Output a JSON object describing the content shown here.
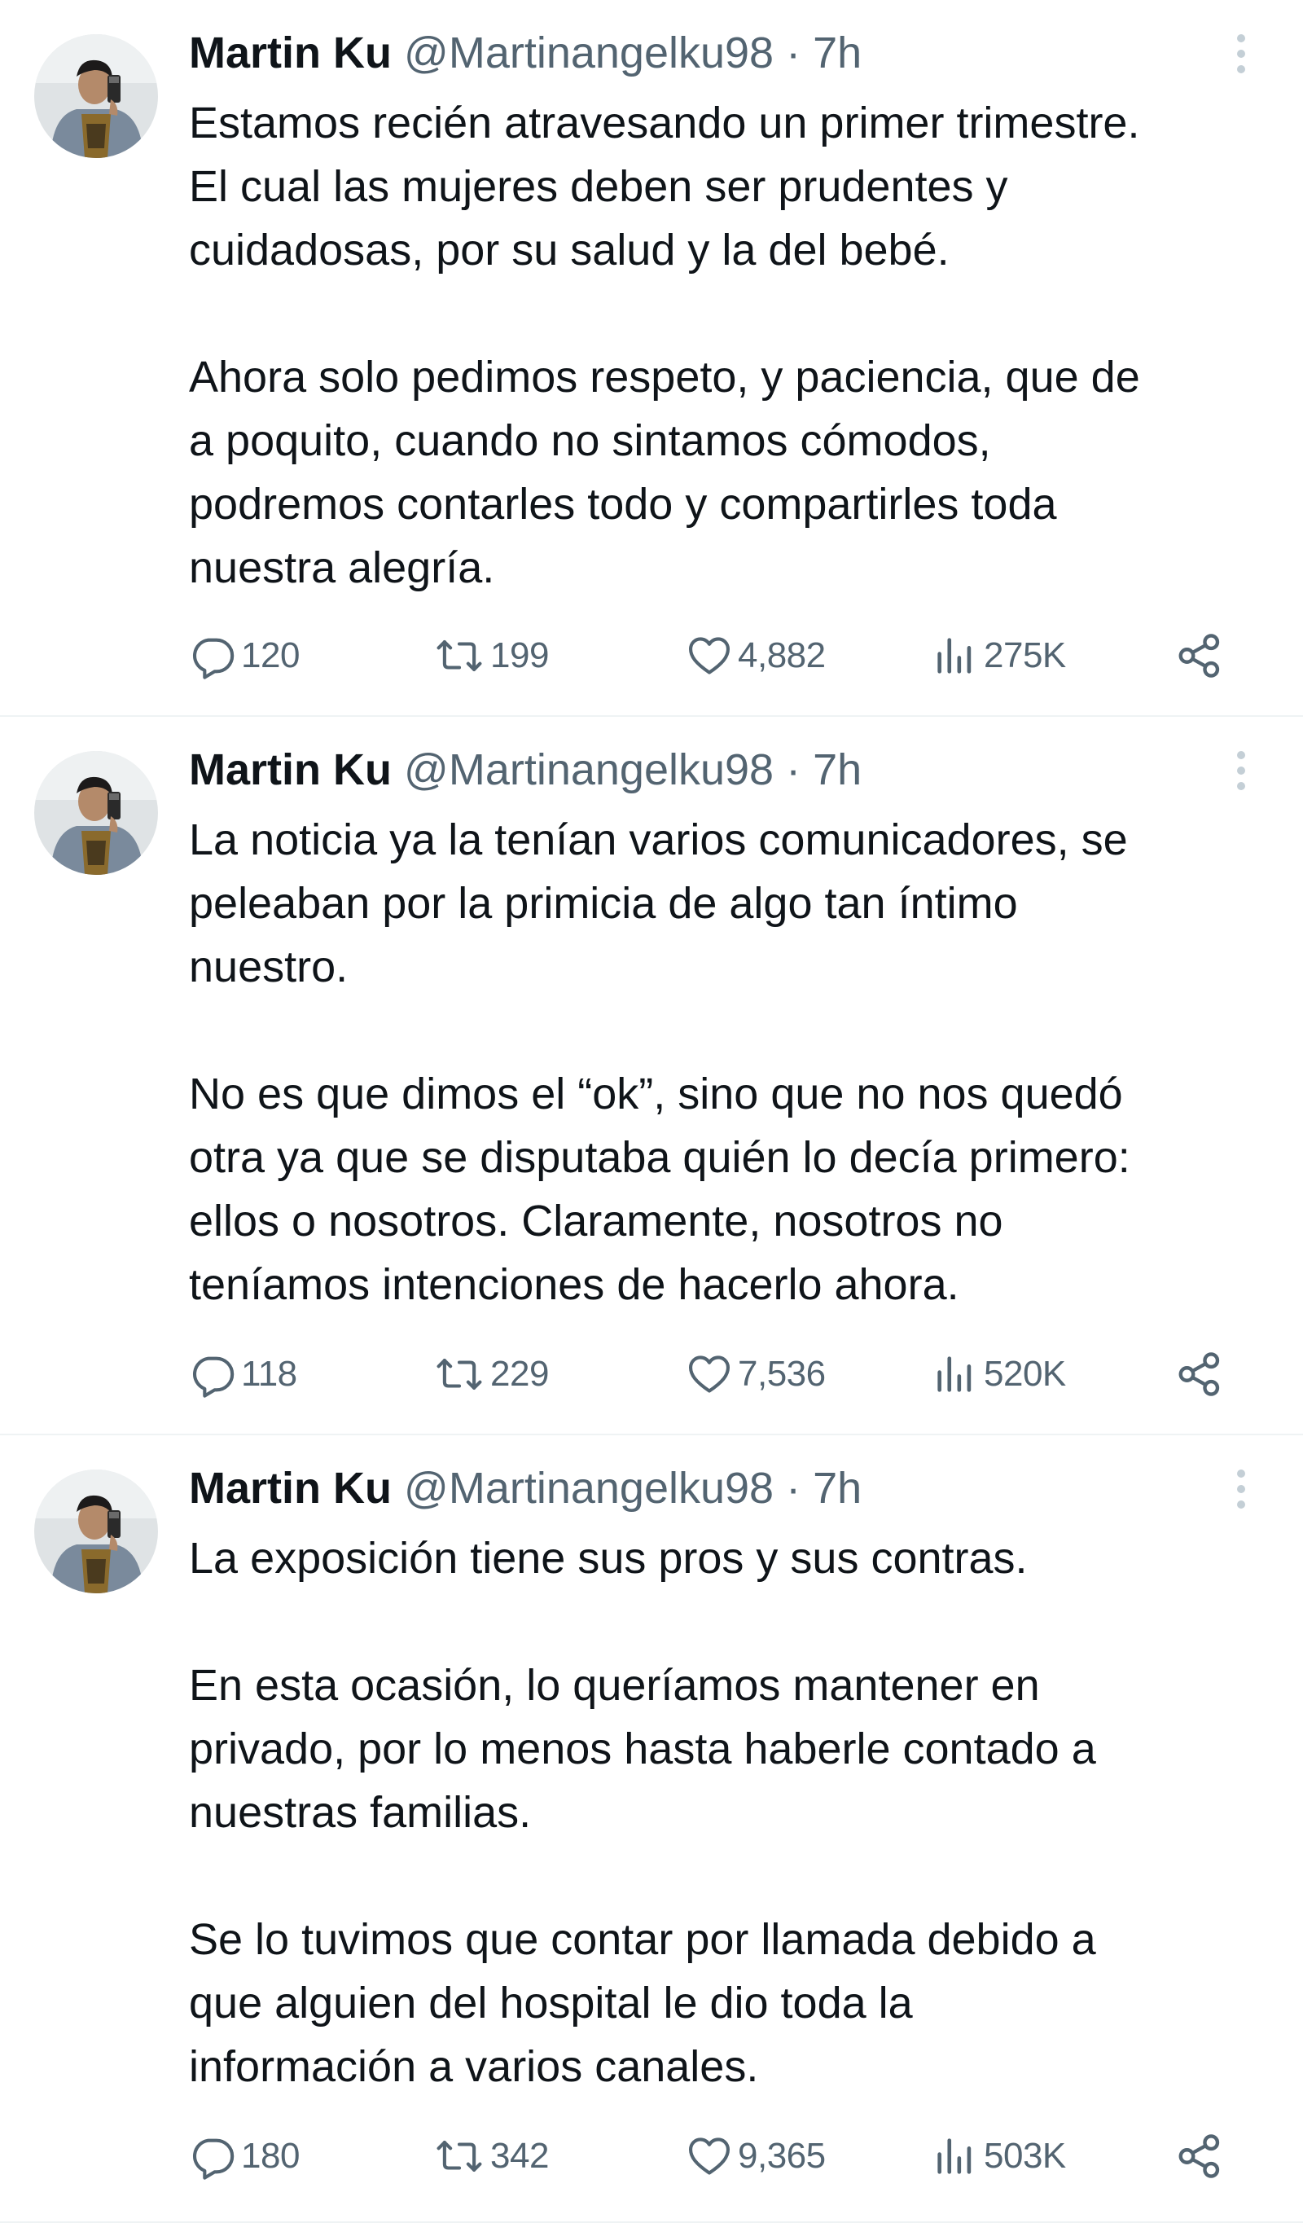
{
  "colors": {
    "text": "#0f1419",
    "secondary": "#536471",
    "divider": "#eff3f4",
    "more_dots": "#c4cfd6"
  },
  "icons": {
    "reply": "speech-bubble",
    "retweet": "repeat-arrows",
    "like": "heart",
    "views": "bar-chart",
    "share": "share-nodes",
    "more": "vertical-ellipsis"
  },
  "tweets": [
    {
      "name": "Martin Ku",
      "meta": "@Martinangelku98 · 7h",
      "text": "Estamos recién atravesando un primer trimestre.\nEl cual las mujeres deben ser prudentes y\ncuidadosas, por su salud y la del bebé.\n\nAhora solo pedimos respeto, y paciencia, que de\na poquito, cuando no sintamos cómodos,\npodremos contarles todo y compartirles toda\nnuestra alegría.",
      "replies": "120",
      "retweets": "199",
      "likes": "4,882",
      "views": "275K"
    },
    {
      "name": "Martin Ku",
      "meta": "@Martinangelku98 · 7h",
      "text": "La noticia ya la tenían varios comunicadores, se\npeleaban por la primicia de algo tan íntimo\nnuestro.\n\nNo es que dimos el “ok”, sino que no nos quedó\notra ya que se disputaba quién lo decía primero:\nellos o nosotros. Claramente, nosotros no\nteníamos intenciones de hacerlo ahora.",
      "replies": "118",
      "retweets": "229",
      "likes": "7,536",
      "views": "520K"
    },
    {
      "name": "Martin Ku",
      "meta": "@Martinangelku98 · 7h",
      "text": "La exposición tiene sus pros y sus contras.\n\nEn esta ocasión, lo queríamos mantener en\nprivado, por lo menos hasta haberle contado a\nnuestras familias.\n\nSe lo tuvimos que contar por llamada debido a\nque alguien del hospital le dio toda la\ninformación a varios canales.",
      "replies": "180",
      "retweets": "342",
      "likes": "9,365",
      "views": "503K"
    }
  ]
}
